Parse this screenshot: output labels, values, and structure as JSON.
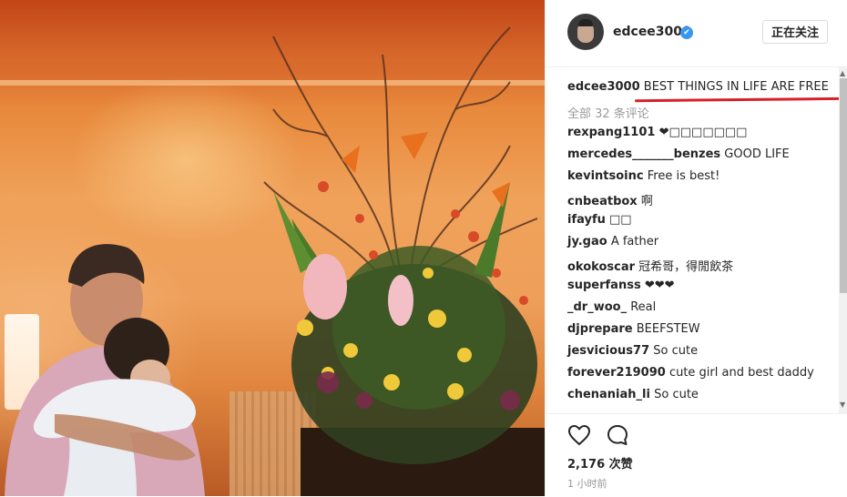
{
  "post": {
    "username": "edcee3000",
    "verified_icon": "verified-badge-icon",
    "follow_label": "正在关注",
    "caption_user": "edcee3000",
    "caption_text": "BEST THINGS IN LIFE ARE FREE",
    "all_comments": "全部 32 条评论",
    "likes": "2,176 次赞",
    "time": "1 小时前"
  },
  "comments": [
    {
      "user": "rexpang1101",
      "text": "❤□□□□□□□"
    },
    {
      "user": "mercedes_______benzes",
      "text": "GOOD LIFE"
    },
    {
      "user": "kevintsoinc",
      "text": "Free is best!"
    },
    {
      "user": "cnbeatbox",
      "text": "啊"
    },
    {
      "user": "ifayfu",
      "text": "□□"
    },
    {
      "user": "jy.gao",
      "text": "A father"
    },
    {
      "user": "okokoscar",
      "text": "冠希哥，得閒飲茶"
    },
    {
      "user": "superfanss",
      "text": "❤❤❤"
    },
    {
      "user": "_dr_woo_",
      "text": "Real"
    },
    {
      "user": "djprepare",
      "text": "BEEFSTEW"
    },
    {
      "user": "jesvicious77",
      "text": "So cute"
    },
    {
      "user": "forever219090",
      "text": "cute girl and best daddy"
    },
    {
      "user": "chenaniah_li",
      "text": "So cute"
    }
  ],
  "icons": {
    "like": "heart-icon",
    "comment": "speech-bubble-icon"
  },
  "colors": {
    "accent_blue": "#3897f0",
    "annotation_red": "#d8202a",
    "muted_text": "#999999"
  }
}
